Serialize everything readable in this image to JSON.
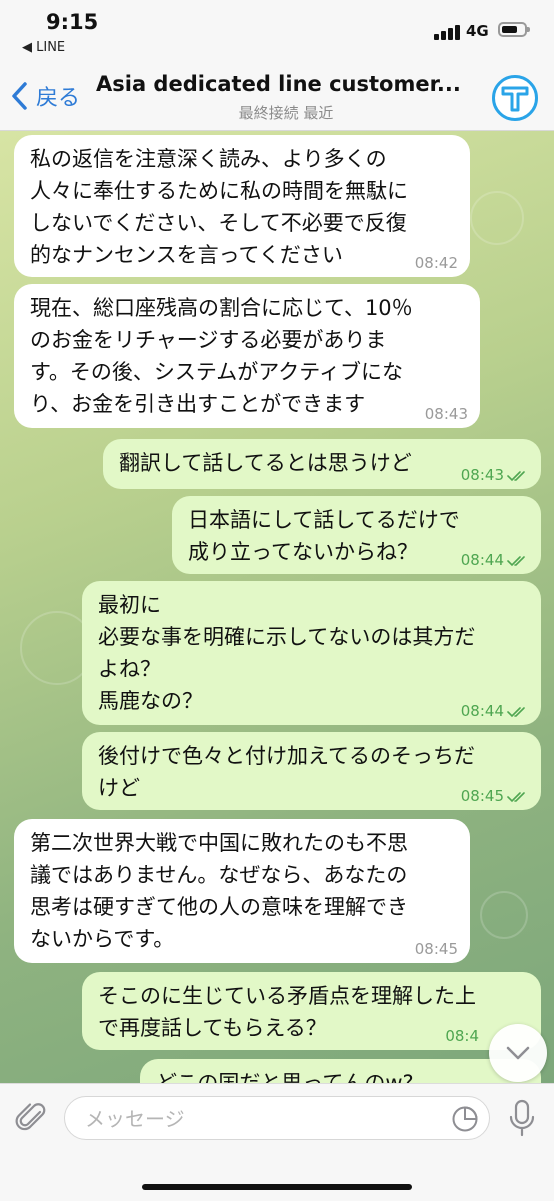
{
  "status_bar": {
    "time": "9:15",
    "back_app": "◀ LINE",
    "network": "4G"
  },
  "header": {
    "back_label": "戻る",
    "title": "Asia dedicated line customer...",
    "subtitle": "最終接続 最近"
  },
  "messages": [
    {
      "dir": "in",
      "text": "私の返信を注意深く読み、より多くの\n人々に奉仕するために私の時間を無駄に\nしないでください、そして不必要で反復\n的なナンセンスを言ってください",
      "time": "08:42"
    },
    {
      "dir": "in",
      "text": "現在、総口座残高の割合に応じて、10％\nのお金をリチャージする必要がありま\nす。その後、システムがアクティブにな\nり、お金を引き出すことができます",
      "time": "08:43"
    },
    {
      "dir": "out",
      "text": "翻訳して話してるとは思うけど",
      "time": "08:43"
    },
    {
      "dir": "out",
      "text": "日本語にして話してるだけで\n成り立ってないからね？",
      "time": "08:44"
    },
    {
      "dir": "out",
      "text": "最初に\n必要な事を明確に示してないのは其方だ\nよね？\n馬鹿なの？",
      "time": "08:44"
    },
    {
      "dir": "out",
      "text": "後付けで色々と付け加えてるのそっちだ\nけど",
      "time": "08:45"
    },
    {
      "dir": "in",
      "text": "第二次世界大戦で中国に敗れたのも不思\n議ではありません。なぜなら、あなたの\n思考は硬すぎて他の人の意味を理解でき\nないからです。",
      "time": "08:45"
    },
    {
      "dir": "out",
      "text": "そこのに生じている矛盾点を理解した上\nで再度話してもらえる？",
      "time": "08:4"
    },
    {
      "dir": "out",
      "text": "どこの国だと思ってんのw?",
      "time": ""
    }
  ],
  "input": {
    "placeholder": "メッセージ"
  },
  "colors": {
    "accent": "#2e7bd6",
    "outgoing_bubble": "#e2f8c7",
    "check": "#4fa651"
  }
}
